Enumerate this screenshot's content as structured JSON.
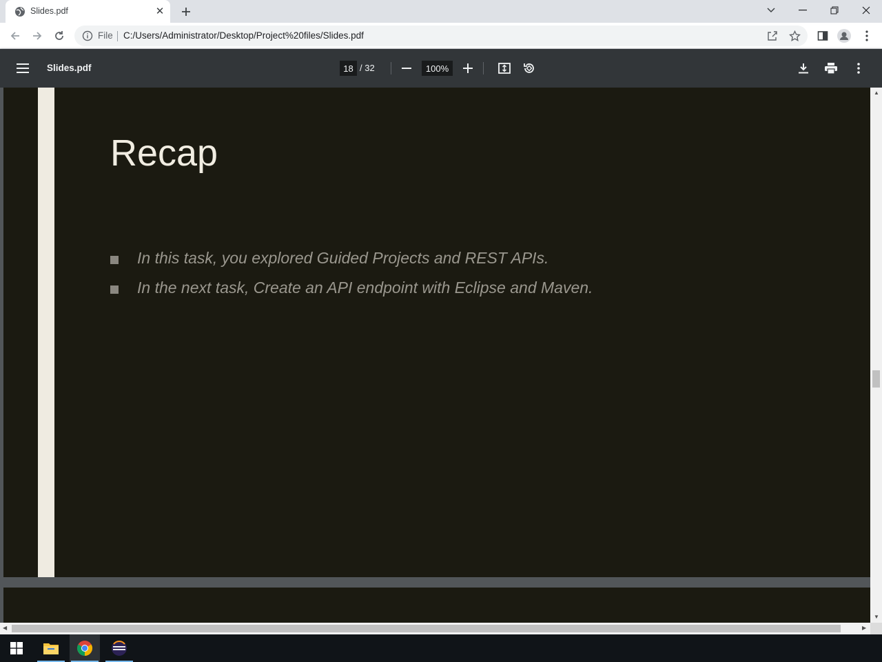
{
  "browser": {
    "tab": {
      "title": "Slides.pdf"
    },
    "address": {
      "scheme_label": "File",
      "url": "C:/Users/Administrator/Desktop/Project%20files/Slides.pdf"
    }
  },
  "pdf_toolbar": {
    "title": "Slides.pdf",
    "current_page": "18",
    "total_pages": "/ 32",
    "zoom": "100%"
  },
  "slide": {
    "title": "Recap",
    "bullets": [
      "In this task, you explored Guided Projects and REST APIs.",
      "In the next task, Create an API endpoint with Eclipse and Maven."
    ]
  },
  "colors": {
    "slide_background": "#1b1a11",
    "slide_accent_bar": "#efebe1",
    "pdf_toolbar": "#323639",
    "viewer_background": "#525659"
  },
  "icons": [
    "globe-icon",
    "close-icon",
    "plus-icon",
    "back-icon",
    "forward-icon",
    "reload-icon",
    "info-icon",
    "share-icon",
    "star-icon",
    "side-panel-icon",
    "profile-icon",
    "kebab-menu-icon",
    "hamburger-icon",
    "zoom-out-icon",
    "zoom-in-icon",
    "fit-page-icon",
    "rotate-icon",
    "download-icon",
    "print-icon",
    "windows-start-icon",
    "file-explorer-icon",
    "chrome-icon",
    "eclipse-icon"
  ]
}
